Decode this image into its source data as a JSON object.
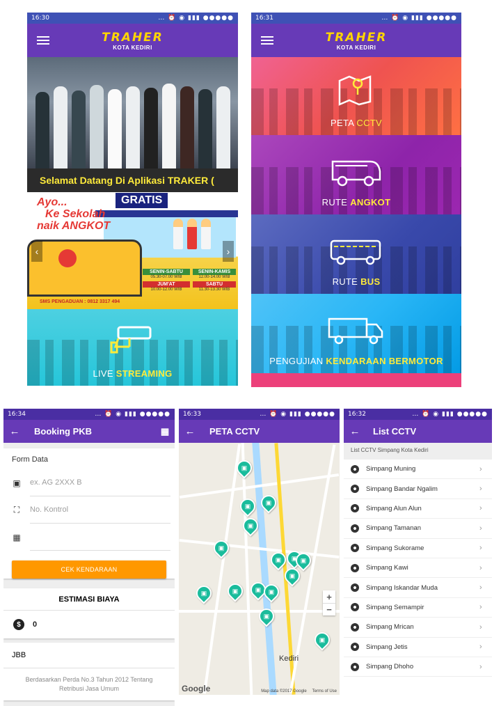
{
  "screen1": {
    "time": "16:30",
    "logo_title": "TRAHER",
    "logo_sub": "KOTA KEDIRI",
    "marquee": "Selamat Datang Di Aplikasi TRAKER (",
    "promo": {
      "line1": "Ayo...",
      "line2": "Ke Sekolah",
      "line3": "naik ANGKOT",
      "gratis": "GRATIS",
      "sched1_title": "SENIN-SABTU",
      "sched1_time": "05.30-07.00 WIB",
      "sched2_title": "SENIN-KAMIS",
      "sched2_time": "12.00-14.00 WIB",
      "sched3_title": "JUM'AT",
      "sched3_time": "10.00-12.00 WIB",
      "sched4_title": "SABTU",
      "sched4_time": "11.30-13.30 WIB",
      "sms": "SMS PENGADUAN : 0812 3317 494"
    },
    "live_plain": "LIVE",
    "live_highlight": "STREAMING"
  },
  "screen2": {
    "time": "16:31",
    "logo_title": "TRAHER",
    "logo_sub": "KOTA KEDIRI",
    "tiles": [
      {
        "plain": "PETA",
        "highlight": "CCTV"
      },
      {
        "plain": "RUTE",
        "highlight": "ANGKOT"
      },
      {
        "plain": "RUTE",
        "highlight": "BUS"
      },
      {
        "plain": "PENGUJIAN",
        "highlight": "KENDARAAN BERMOTOR"
      }
    ]
  },
  "screen3": {
    "time": "16:34",
    "title": "Booking PKB",
    "form_head": "Form Data",
    "plate_placeholder": "ex. AG 2XXX B",
    "kontrol_placeholder": "No. Kontrol",
    "button": "CEK KENDARAAN",
    "estimasi_title": "ESTIMASI BIAYA",
    "estimasi_value": "0",
    "jbb": "JBB",
    "perda": "Berdasarkan Perda No.3 Tahun 2012 Tentang Retribusi Jasa Umum"
  },
  "screen4": {
    "time": "16:33",
    "title": "PETA CCTV",
    "city": "Kediri",
    "google": "Google",
    "map_data": "Map data ©2017 Google",
    "terms": "Terms of Use"
  },
  "screen5": {
    "time": "16:32",
    "title": "List CCTV",
    "subtitle": "List CCTV Simpang Kota Kediri",
    "items": [
      "Simpang Muning",
      "Simpang Bandar Ngalim",
      "Simpang Alun Alun",
      "Simpang Tamanan",
      "Simpang Sukorame",
      "Simpang Kawi",
      "Simpang Iskandar Muda",
      "Simpang Semampir",
      "Simpang Mrican",
      "Simpang Jetis",
      "Simpang Dhoho"
    ]
  },
  "colors": {
    "appbar": "#673ab7",
    "accent_yellow": "#ffeb3b",
    "button_orange": "#ff9800",
    "marker": "#1abc9c"
  }
}
